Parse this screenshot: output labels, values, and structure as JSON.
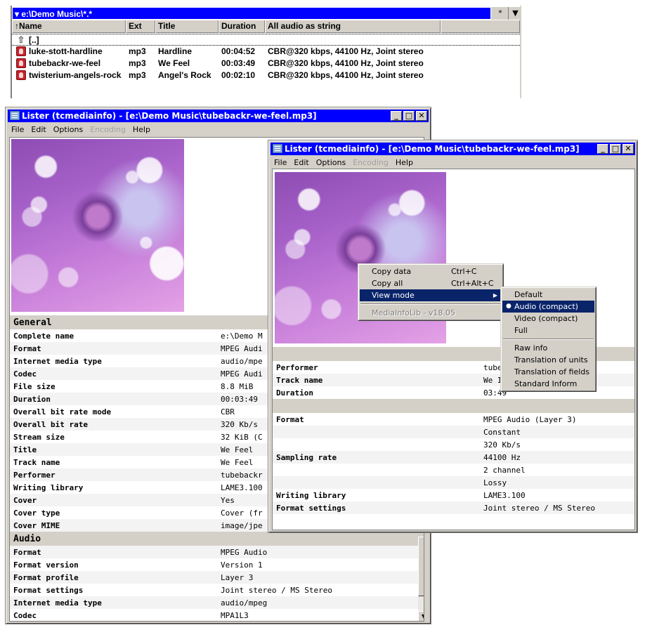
{
  "file_panel": {
    "path": "e:\\Demo Music\\*.*",
    "star_button": "*",
    "columns": [
      "Name",
      "Ext",
      "Title",
      "Duration",
      "All audio as string"
    ],
    "sort_indicator": "↑",
    "updir_label": "[..]",
    "files": [
      {
        "name": "luke-stott-hardline",
        "ext": "mp3",
        "title": "Hardline",
        "duration": "00:04:52",
        "audio": "CBR@320 kbps, 44100 Hz, Joint stereo"
      },
      {
        "name": "tubebackr-we-feel",
        "ext": "mp3",
        "title": "We Feel",
        "duration": "00:03:49",
        "audio": "CBR@320 kbps, 44100 Hz, Joint stereo"
      },
      {
        "name": "twisterium-angels-rock",
        "ext": "mp3",
        "title": "Angel's Rock",
        "duration": "00:02:10",
        "audio": "CBR@320 kbps, 44100 Hz, Joint stereo"
      }
    ]
  },
  "lister_back": {
    "title": "Lister (tcmediainfo) - [e:\\Demo Music\\tubebackr-we-feel.mp3]",
    "menu": [
      "File",
      "Edit",
      "Options",
      "Encoding",
      "Help"
    ],
    "sections": [
      {
        "header": "General",
        "rows": [
          [
            "Complete name",
            "e:\\Demo M"
          ],
          [
            "Format",
            "MPEG Audi"
          ],
          [
            "Internet media type",
            "audio/mpe"
          ],
          [
            "Codec",
            "MPEG Audi"
          ],
          [
            "File size",
            "8.8 MiB"
          ],
          [
            "Duration",
            "00:03:49"
          ],
          [
            "Overall bit rate mode",
            "CBR"
          ],
          [
            "Overall bit rate",
            "320 Kb/s"
          ],
          [
            "Stream size",
            "32 KiB (C"
          ],
          [
            "Title",
            "We Feel"
          ],
          [
            "Track name",
            "We Feel"
          ],
          [
            "Performer",
            "tubebackr"
          ],
          [
            "Writing library",
            "LAME3.100"
          ],
          [
            "Cover",
            "Yes"
          ],
          [
            "Cover type",
            "Cover (fr"
          ],
          [
            "Cover MIME",
            "image/jpe"
          ]
        ]
      },
      {
        "header": "Audio",
        "rows": [
          [
            "Format",
            "MPEG Audio"
          ],
          [
            "Format version",
            "Version 1"
          ],
          [
            "Format profile",
            "Layer 3"
          ],
          [
            "Format settings",
            "Joint stereo / MS Stereo"
          ],
          [
            "Internet media type",
            "audio/mpeg"
          ],
          [
            "Codec",
            "MPA1L3"
          ]
        ]
      }
    ]
  },
  "lister_front": {
    "title": "Lister (tcmediainfo) - [e:\\Demo Music\\tubebackr-we-feel.mp3]",
    "menu": [
      "File",
      "Edit",
      "Options",
      "Encoding",
      "Help"
    ],
    "sections": [
      {
        "header": "",
        "rows": [
          [
            "Performer",
            "tube"
          ],
          [
            "Track name",
            "We I"
          ],
          [
            "Duration",
            "03:49"
          ]
        ]
      },
      {
        "header": "",
        "rows": [
          [
            "Format",
            "MPEG Audio (Layer 3)"
          ],
          [
            "",
            "Constant"
          ],
          [
            "",
            "320 Kb/s"
          ],
          [
            "Sampling rate",
            "44100 Hz"
          ],
          [
            "",
            "2 channel"
          ],
          [
            "",
            "Lossy"
          ],
          [
            "Writing library",
            "LAME3.100"
          ],
          [
            "Format settings",
            "Joint stereo / MS Stereo"
          ]
        ]
      }
    ]
  },
  "context_menu": {
    "items": [
      {
        "label": "Copy data",
        "shortcut": "Ctrl+C"
      },
      {
        "label": "Copy all",
        "shortcut": "Ctrl+Alt+C"
      },
      {
        "label": "View mode",
        "submenu": true,
        "selected": true
      },
      {
        "separator": true
      },
      {
        "label": "MediaInfoLib - v18.05",
        "disabled": true
      }
    ]
  },
  "view_mode_submenu": {
    "items": [
      {
        "label": "Default"
      },
      {
        "label": "Audio (compact)",
        "checked": true,
        "selected": true
      },
      {
        "label": "Video (compact)"
      },
      {
        "label": "Full"
      },
      {
        "separator": true
      },
      {
        "label": "Raw info"
      },
      {
        "label": "Translation of units"
      },
      {
        "label": "Translation of fields"
      },
      {
        "label": "Standard Inform"
      }
    ]
  },
  "colors": {
    "titlebar": "#0000ff",
    "menu_highlight": "#0a246a",
    "window_face": "#d4d0c8"
  }
}
